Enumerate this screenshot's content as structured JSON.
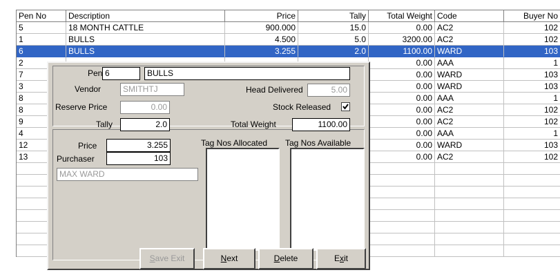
{
  "grid": {
    "headers": [
      "Pen No",
      "Description",
      "Price",
      "Tally",
      "Total Weight",
      "Code",
      "Buyer No"
    ],
    "rows": [
      [
        "5",
        "18 MONTH CATTLE",
        "900.000",
        "15.0",
        "0.00",
        "AC2",
        "102"
      ],
      [
        "1",
        "BULLS",
        "4.500",
        "5.0",
        "3200.00",
        "AC2",
        "102"
      ],
      [
        "6",
        "BULLS",
        "3.255",
        "2.0",
        "1100.00",
        "WARD",
        "103"
      ],
      [
        "2",
        "",
        "",
        "",
        "0.00",
        "AAA",
        "1"
      ],
      [
        "7",
        "",
        "",
        "",
        "0.00",
        "WARD",
        "103"
      ],
      [
        "3",
        "",
        "",
        "",
        "0.00",
        "WARD",
        "103"
      ],
      [
        "8",
        "",
        "",
        "",
        "0.00",
        "AAA",
        "1"
      ],
      [
        "8",
        "",
        "",
        "",
        "0.00",
        "AC2",
        "102"
      ],
      [
        "9",
        "",
        "",
        "",
        "0.00",
        "AC2",
        "102"
      ],
      [
        "4",
        "",
        "",
        "",
        "0.00",
        "AAA",
        "1"
      ],
      [
        "12",
        "",
        "",
        "",
        "0.00",
        "WARD",
        "103"
      ],
      [
        "13",
        "",
        "",
        "",
        "0.00",
        "AC2",
        "102"
      ]
    ],
    "selected_row": 2,
    "empty_rows": 8
  },
  "dialog": {
    "pen_label": "Pen",
    "pen_value": "6",
    "description_value": "BULLS",
    "vendor_label": "Vendor",
    "vendor_value": "SMITHTJ",
    "head_delivered_label": "Head Delivered",
    "head_delivered_value": "5.00",
    "reserve_price_label": "Reserve Price",
    "reserve_price_value": "0.00",
    "stock_released_label": "Stock Released",
    "stock_released_checked": true,
    "tally_label": "Tally",
    "tally_value": "2.0",
    "total_weight_label": "Total Weight",
    "total_weight_value": "1100.00",
    "price_label": "Price",
    "price_value": "3.255",
    "purchaser_label": "Purchaser",
    "purchaser_value": "103",
    "purchaser_name": "MAX WARD",
    "tag_allocated_label": "Tag Nos Allocated",
    "tag_available_label": "Tag Nos Available",
    "buttons": {
      "save_exit": "Save  Exit",
      "next": "Next",
      "delete": "Delete",
      "exit": "Exit"
    }
  },
  "icons": {
    "check": "checkmark-icon"
  },
  "colors": {
    "selection": "#3165c5",
    "dialog_face": "#d4d0c8"
  }
}
